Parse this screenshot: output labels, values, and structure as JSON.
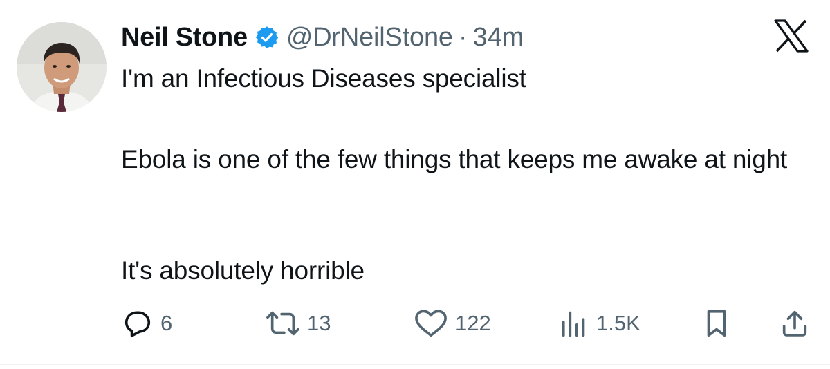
{
  "author": {
    "name": "Neil Stone",
    "handle": "@DrNeilStone",
    "separator": "·",
    "time": "34m",
    "verified": true
  },
  "tweet": {
    "paragraphs": [
      "I'm an Infectious Diseases specialist",
      "Ebola is one of the few things that keeps me awake at night",
      "It's absolutely horrible"
    ]
  },
  "actions": {
    "replies": "6",
    "reposts": "13",
    "likes": "122",
    "views": "1.5K"
  },
  "colors": {
    "text": "#0f1419",
    "secondary": "#536471",
    "verified_blue": "#1d9bf0"
  },
  "icons": [
    "verified-badge-icon",
    "x-logo-icon",
    "reply-icon",
    "repost-icon",
    "like-icon",
    "views-icon",
    "bookmark-icon",
    "share-icon"
  ]
}
